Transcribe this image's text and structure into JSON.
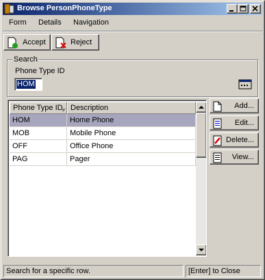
{
  "window": {
    "title": "Browse PersonPhoneType",
    "title_bar_color": "#0a246a"
  },
  "menu": {
    "items": [
      {
        "label": "Form"
      },
      {
        "label": "Details"
      },
      {
        "label": "Navigation"
      }
    ]
  },
  "toolbar": {
    "accept_label": "Accept",
    "reject_label": "Reject"
  },
  "search": {
    "group_label": "Search",
    "field_label": "Phone Type ID",
    "value": "HOM"
  },
  "grid": {
    "columns": [
      "Phone Type ID",
      "Description"
    ],
    "rows": [
      {
        "id": "HOM",
        "description": "Home Phone",
        "selected": true
      },
      {
        "id": "MOB",
        "description": "Mobile Phone",
        "selected": false
      },
      {
        "id": "OFF",
        "description": "Office Phone",
        "selected": false
      },
      {
        "id": "PAG",
        "description": "Pager",
        "selected": false
      }
    ],
    "selection_color": "#a7a6be"
  },
  "side_buttons": {
    "add_label": "Add...",
    "edit_label": "Edit...",
    "delete_label": "Delete...",
    "view_label": "View..."
  },
  "status": {
    "message": "Search for a specific row.",
    "hint": "[Enter] to Close"
  }
}
